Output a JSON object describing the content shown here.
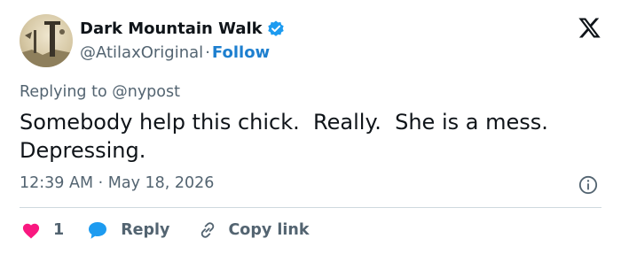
{
  "author": {
    "display_name": "Dark Mountain Walk",
    "handle": "@AtilaxOriginal",
    "separator": "·",
    "follow_label": "Follow"
  },
  "reply_context": "Replying to @nypost",
  "tweet": {
    "text": "Somebody help this chick.  Really.  She is a mess.\nDepressing.",
    "timestamp": "12:39 AM · May 18, 2026"
  },
  "actions": {
    "like_count": "1",
    "reply_label": "Reply",
    "copy_label": "Copy link"
  },
  "icons": [
    "verified-badge-icon",
    "x-logo-icon",
    "info-icon",
    "heart-icon",
    "reply-bubble-icon",
    "link-icon"
  ],
  "colors": {
    "text": "#0f1419",
    "secondary": "#536471",
    "accent": "#1d9bf0",
    "follow": "#1d7fcf",
    "like": "#f91880",
    "divider": "#cfd9de"
  }
}
